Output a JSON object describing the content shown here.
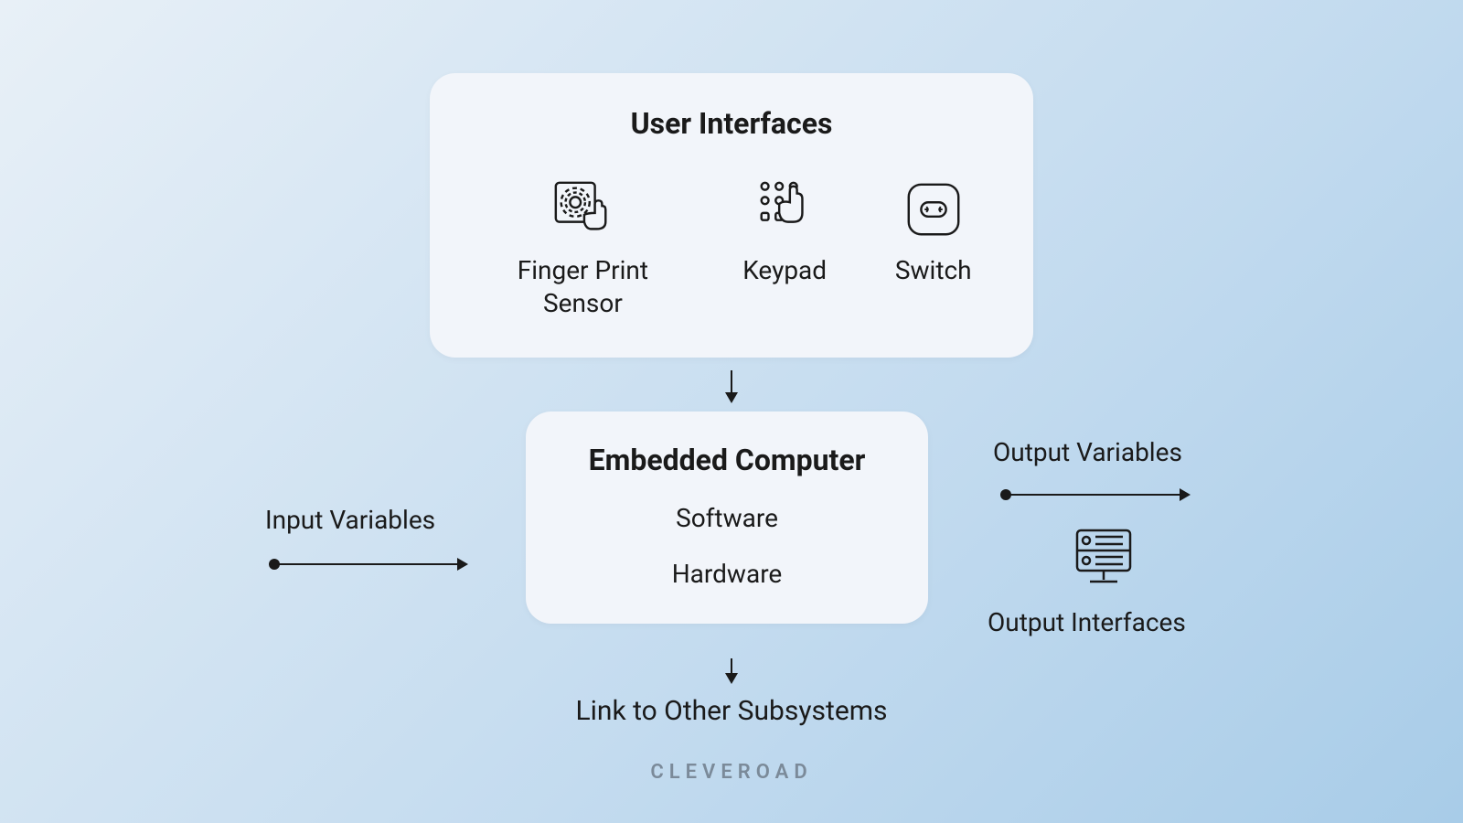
{
  "ui_card": {
    "title": "User Interfaces",
    "items": [
      {
        "label": "Finger Print Sensor",
        "icon": "fingerprint-sensor-icon"
      },
      {
        "label": "Keypad",
        "icon": "keypad-icon"
      },
      {
        "label": "Switch",
        "icon": "switch-icon"
      }
    ]
  },
  "ec_card": {
    "title": "Embedded Computer",
    "rows": [
      "Software",
      "Hardware"
    ]
  },
  "input_label": "Input Variables",
  "output_label": "Output Variables",
  "output_interfaces_label": "Output Interfaces",
  "subsystems_label": "Link to Other Subsystems",
  "brand": "CLEVEROAD"
}
